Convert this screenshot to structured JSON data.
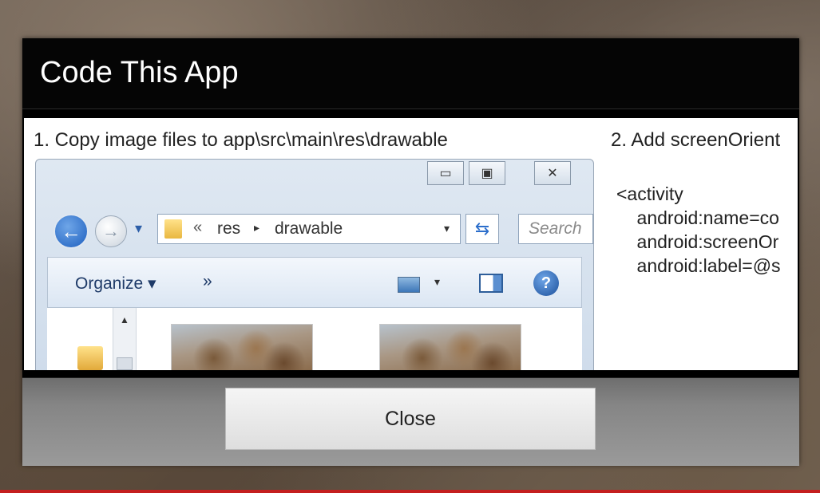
{
  "dialog": {
    "title": "Code This App",
    "close_label": "Close"
  },
  "steps": {
    "step1": "1. Copy image files to app\\src\\main\\res\\drawable",
    "step2": "2. Add screenOrient",
    "code_lines": [
      "<activity",
      "    android:name=co",
      "    android:screenOr",
      "    android:label=@s"
    ]
  },
  "explorer": {
    "window_buttons": [
      "▭",
      "▣",
      "✕"
    ],
    "address": {
      "chevron": "«",
      "segment1": "res",
      "arrow": "▸",
      "segment2": "drawable",
      "dropdown": "▾"
    },
    "search_placeholder": "Search",
    "toolbar": {
      "organize_label": "Organize ▾",
      "more_label": "»",
      "view_dropdown": "▾",
      "help_label": "?"
    },
    "nav": {
      "back_glyph": "←",
      "forward_glyph": "→",
      "history_dropdown": "▾"
    },
    "refresh_glyph": "⇆",
    "scroll_up": "▲"
  }
}
